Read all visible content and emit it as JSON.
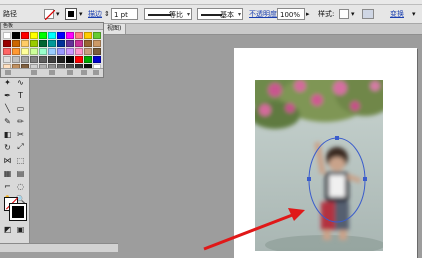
{
  "controlbar": {
    "object_label": "路径",
    "stroke_label": "描边",
    "stroke_weight": "1 pt",
    "stroke_profile_label": "等比",
    "brush_label": "基本",
    "opacity_label": "不透明度",
    "opacity_value": "100%",
    "style_label": "样式:",
    "transform_label": "变换"
  },
  "document": {
    "tab_label": "视图)"
  },
  "swatches": {
    "title": "色板",
    "colors": [
      "#ffffff",
      "#000000",
      "#ff0000",
      "#ffff00",
      "#00ff00",
      "#00ffff",
      "#0000ff",
      "#ff00ff",
      "#ff8080",
      "#ffcc00",
      "#66cc33",
      "#990000",
      "#cc6600",
      "#ffcc66",
      "#99cc00",
      "#006633",
      "#009999",
      "#003399",
      "#663399",
      "#cc3399",
      "#996633",
      "#cc9966",
      "#ff6666",
      "#ff9933",
      "#ffff99",
      "#ccff99",
      "#99ffcc",
      "#99ccff",
      "#9999ff",
      "#cc99ff",
      "#ff99cc",
      "#c8a080",
      "#7a5c3a",
      "#e0e0e0",
      "#c0c0c0",
      "#a0a0a0",
      "#808080",
      "#606060",
      "#404040",
      "#202020",
      "#000000",
      "#ff0000",
      "#00aa00",
      "#0000cc",
      "#ffe0c0",
      "#c09060",
      "#806040",
      "#d0d0d0",
      "#b0b0b0",
      "#909090",
      "#707070",
      "#505050",
      "#303030",
      "#101010",
      "#ffffff"
    ]
  },
  "colors": {
    "annotation_arrow": "#e01818",
    "selection_path": "#3a5ccc"
  }
}
